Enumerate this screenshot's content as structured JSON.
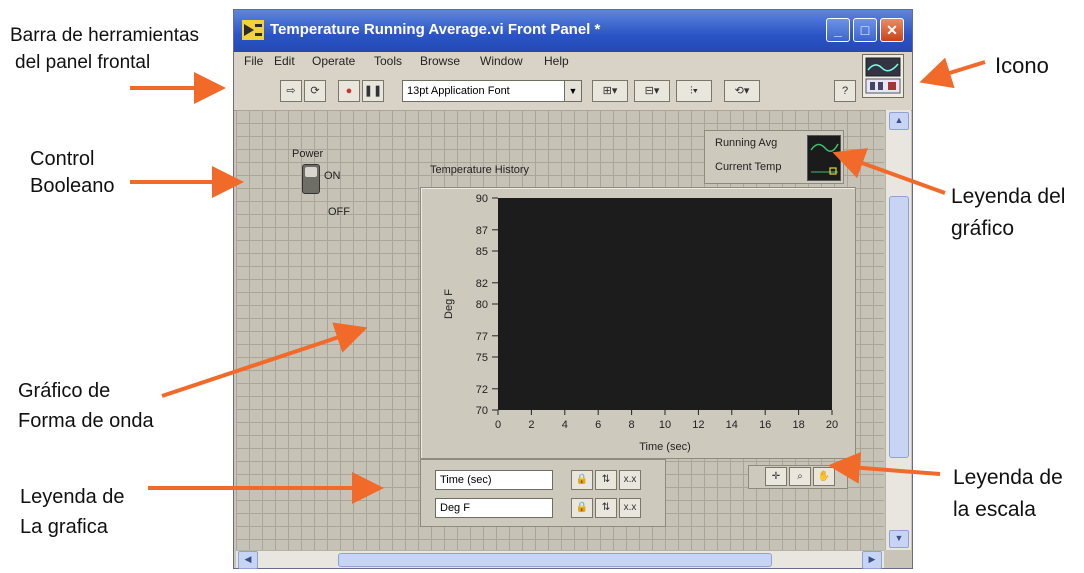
{
  "annotations": {
    "toolbar_label_line1": "Barra de herramientas",
    "toolbar_label_line2": "del panel frontal",
    "icon_label": "Icono",
    "boolean_label_line1": "Control",
    "boolean_label_line2": "Booleano",
    "legend_label_line1": "Leyenda del",
    "legend_label_line2": "gráfico",
    "waveform_label_line1": "Gráfico de",
    "waveform_label_line2": "Forma de onda",
    "plot_legend_label_line1": "Leyenda de",
    "plot_legend_label_line2": "La grafica",
    "scale_legend_label_line1": "Leyenda de",
    "scale_legend_label_line2": "la escala",
    "arrow_color": "#f26a2a"
  },
  "window": {
    "title": "Temperature Running Average.vi Front Panel *",
    "titlebar_color": "#2a54c6"
  },
  "menu": {
    "items": [
      "File",
      "Edit",
      "Operate",
      "Tools",
      "Browse",
      "Window",
      "Help"
    ]
  },
  "toolbar": {
    "font_selector": "13pt Application Font"
  },
  "boolean_control": {
    "label": "Power",
    "on_text": "ON",
    "off_text": "OFF"
  },
  "chart": {
    "title": "Temperature History",
    "plot_area_color": "#1c1c1c",
    "legend_entries": [
      "Running Avg",
      "Current Temp"
    ]
  },
  "scale_legend": {
    "x_name": "Time (sec)",
    "y_name": "Deg F"
  },
  "chart_data": {
    "type": "line",
    "title": "Temperature History",
    "xlabel": "Time (sec)",
    "ylabel": "Deg F",
    "xlim": [
      0,
      20
    ],
    "ylim": [
      70,
      90
    ],
    "x_ticks": [
      "0",
      "2",
      "4",
      "6",
      "8",
      "10",
      "12",
      "14",
      "16",
      "18",
      "20"
    ],
    "x_tick_values": [
      0,
      2,
      4,
      6,
      8,
      10,
      12,
      14,
      16,
      18,
      20
    ],
    "y_ticks": [
      "70",
      "72",
      "75",
      "77",
      "80",
      "82",
      "85",
      "87",
      "90"
    ],
    "y_tick_values": [
      70,
      72,
      75,
      77,
      80,
      82,
      85,
      87,
      90
    ],
    "series": [
      {
        "name": "Running Avg",
        "values": []
      },
      {
        "name": "Current Temp",
        "values": []
      }
    ],
    "grid": false
  }
}
